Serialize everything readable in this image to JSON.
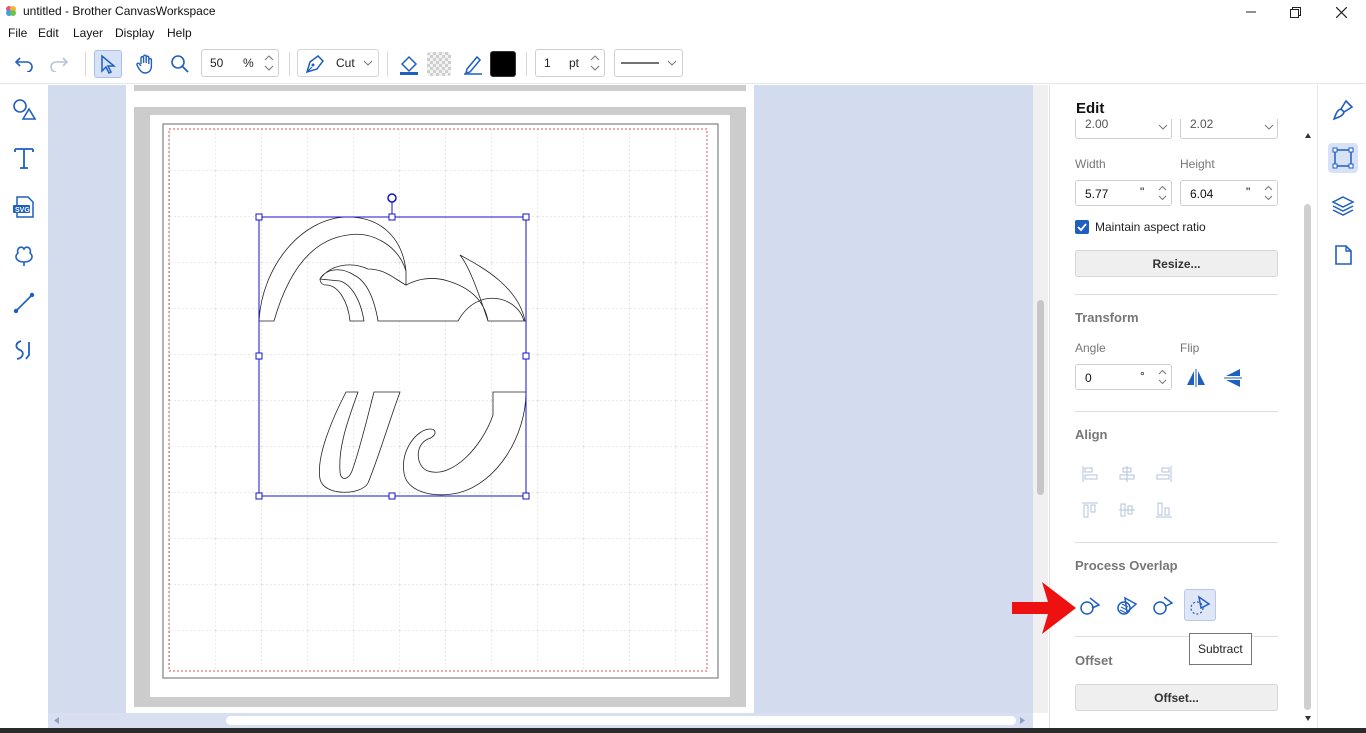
{
  "window": {
    "title": "untitled - Brother CanvasWorkspace"
  },
  "menu": [
    "File",
    "Edit",
    "Layer",
    "Display",
    "Help"
  ],
  "toolbar": {
    "zoom_value": "50",
    "zoom_unit": "%",
    "mode_label": "Cut",
    "line_width_value": "1",
    "line_width_unit": "pt",
    "stroke_color": "#000000"
  },
  "panel": {
    "title": "Edit",
    "cut_top_left": "2.00",
    "cut_top_right": "2.02",
    "width_label": "Width",
    "height_label": "Height",
    "width_value": "5.77",
    "height_value": "6.04",
    "unit_inch": "\"",
    "maintain_aspect_label": "Maintain aspect ratio",
    "maintain_aspect_checked": true,
    "resize_button": "Resize...",
    "transform_title": "Transform",
    "angle_label": "Angle",
    "flip_label": "Flip",
    "angle_value": "0",
    "angle_unit": "°",
    "align_title": "Align",
    "process_overlap_title": "Process Overlap",
    "offset_title": "Offset",
    "offset_button": "Offset..."
  },
  "tooltip": "Subtract",
  "colors": {
    "accent": "#1f5fbf",
    "selection": "#1414c8",
    "canvas_bg": "#d3dcef",
    "annotation_arrow": "#ee1111"
  },
  "icons": {
    "left_toolbar": [
      "shapes-icon",
      "text-icon",
      "svg-import-icon",
      "pattern-icon",
      "line-icon",
      "freehand-icon"
    ],
    "right_tabs": [
      "paint-icon",
      "edit-transform-icon",
      "layers-icon",
      "page-icon"
    ]
  }
}
